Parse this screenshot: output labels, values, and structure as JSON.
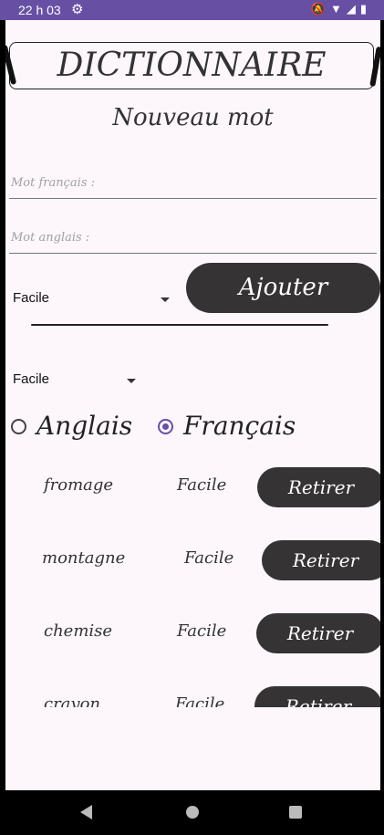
{
  "status_bar": {
    "time": "22 h 03",
    "left_icons": [
      "gear-icon"
    ],
    "right_icons": [
      "mute-icon",
      "wifi-icon",
      "signal-icon",
      "battery-icon"
    ]
  },
  "header": {
    "title": "DICTIONNAIRE",
    "subtitle": "Nouveau mot"
  },
  "form": {
    "french_placeholder": "Mot français :",
    "english_placeholder": "Mot anglais :",
    "difficulty_selected": "Facile",
    "add_button": "Ajouter"
  },
  "filter": {
    "difficulty_selected": "Facile",
    "languages": [
      {
        "label": "Anglais",
        "checked": false
      },
      {
        "label": "Français",
        "checked": true
      }
    ]
  },
  "word_list": {
    "rows": [
      {
        "word": "fromage",
        "level": "Facile",
        "button": "Retirer"
      },
      {
        "word": "montagne",
        "level": "Facile",
        "button": "Retirer"
      },
      {
        "word": "chemise",
        "level": "Facile",
        "button": "Retirer"
      },
      {
        "word": "crayon",
        "level": "Facile",
        "button": "Retirer"
      }
    ]
  },
  "colors": {
    "status_bar": "#6750a4",
    "background": "#fdf7fb",
    "button": "#353334",
    "radio_accent": "#6750a4"
  },
  "navigation_bar": {
    "icons": [
      "back-icon",
      "home-icon",
      "recents-icon"
    ]
  }
}
